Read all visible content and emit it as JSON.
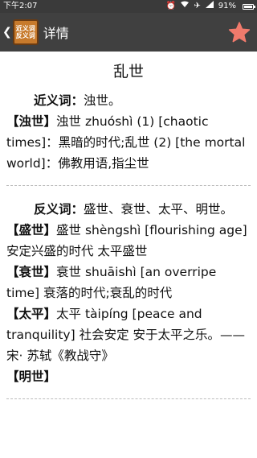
{
  "status_bar": {
    "time": "下午2:07",
    "battery_percent": "91%"
  },
  "app_bar": {
    "logo_line1": "近义词",
    "logo_line2": "反义词",
    "title": "详情"
  },
  "word": "乱世",
  "synonyms": {
    "label": "近义词：",
    "value": "浊世。",
    "entries": [
      {
        "head": "【浊世】",
        "body": "浊世 zhuóshì (1) [chaotic times]：黑暗的时代;乱世 (2) [the mortal world]：佛教用语,指尘世"
      }
    ]
  },
  "antonyms": {
    "label": "反义词：",
    "value": "盛世、衰世、太平、明世。",
    "entries": [
      {
        "head": "【盛世】",
        "body": "盛世 shèngshì [flourishing age] 安定兴盛的时代 太平盛世"
      },
      {
        "head": "【衰世】",
        "body": "衰世 shuāishì [an overripe time] 衰落的时代;衰乱的时代"
      },
      {
        "head": "【太平】",
        "body": "太平 tàipíng [peace and tranquility] 社会安定 安于太平之乐。——宋· 苏轼《教战守》"
      },
      {
        "head": "【明世】",
        "body": ""
      }
    ]
  }
}
